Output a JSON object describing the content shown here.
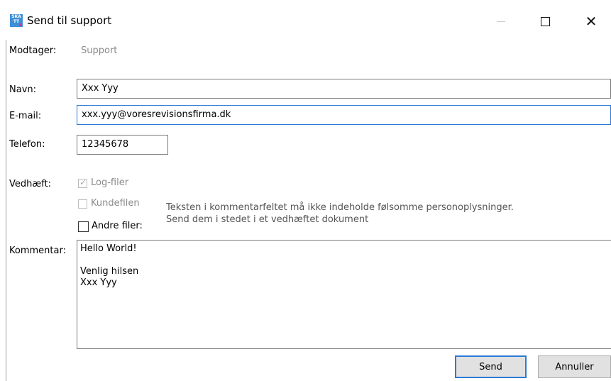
{
  "window": {
    "title": "Send til support",
    "app_icon_text": "SKA\nTT",
    "icons": {
      "minimize": "minimize-icon",
      "maximize": "maximize-icon",
      "close": "close-icon"
    }
  },
  "form": {
    "recipient": {
      "label": "Modtager:",
      "value": "Support"
    },
    "name": {
      "label": "Navn:",
      "value": "Xxx Yyy"
    },
    "email": {
      "label": "E-mail:",
      "value": "xxx.yyy@voresrevisionsfirma.dk"
    },
    "phone": {
      "label": "Telefon:",
      "value": "12345678"
    },
    "attach": {
      "label": "Vedhæft:",
      "log_files": {
        "label": "Log-filer",
        "checked": true,
        "enabled": false
      },
      "customer_file": {
        "label": "Kundefilen",
        "checked": false,
        "enabled": false
      },
      "other_files": {
        "label": "Andre filer:",
        "checked": false,
        "enabled": true
      }
    },
    "note_line1": "Teksten i kommentarfeltet må ikke indeholde følsomme personoplysninger.",
    "note_line2": "Send dem i stedet i et vedhæftet dokument",
    "comment": {
      "label": "Kommentar:",
      "value": "Hello World!\n\nVenlig hilsen\nXxx Yyy"
    }
  },
  "buttons": {
    "send": "Send",
    "cancel": "Annuller"
  }
}
